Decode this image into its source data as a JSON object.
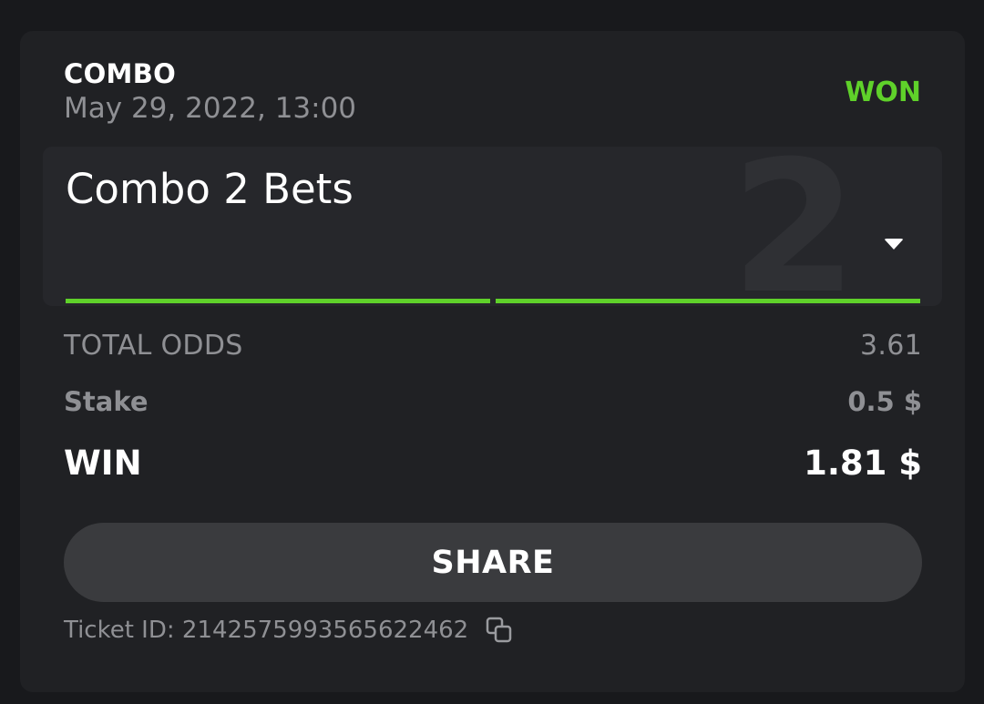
{
  "bet": {
    "type": "COMBO",
    "date": "May 29, 2022, 13:00",
    "status": "WON",
    "status_color": "#5fd12a"
  },
  "combo": {
    "title": "Combo 2 Bets",
    "count": "2",
    "legs": [
      {
        "status": "won",
        "color": "#5fd12a"
      },
      {
        "status": "won",
        "color": "#5fd12a"
      }
    ],
    "expand_icon": "caret-down-icon"
  },
  "summary": {
    "odds_label": "TOTAL ODDS",
    "odds_value": "3.61",
    "stake_label": "Stake",
    "stake_value": "0.5 $",
    "win_label": "WIN",
    "win_value": "1.81 $"
  },
  "share_label": "SHARE",
  "ticket": {
    "label": "Ticket ID: 2142575993565622462",
    "copy_icon": "copy-icon"
  }
}
